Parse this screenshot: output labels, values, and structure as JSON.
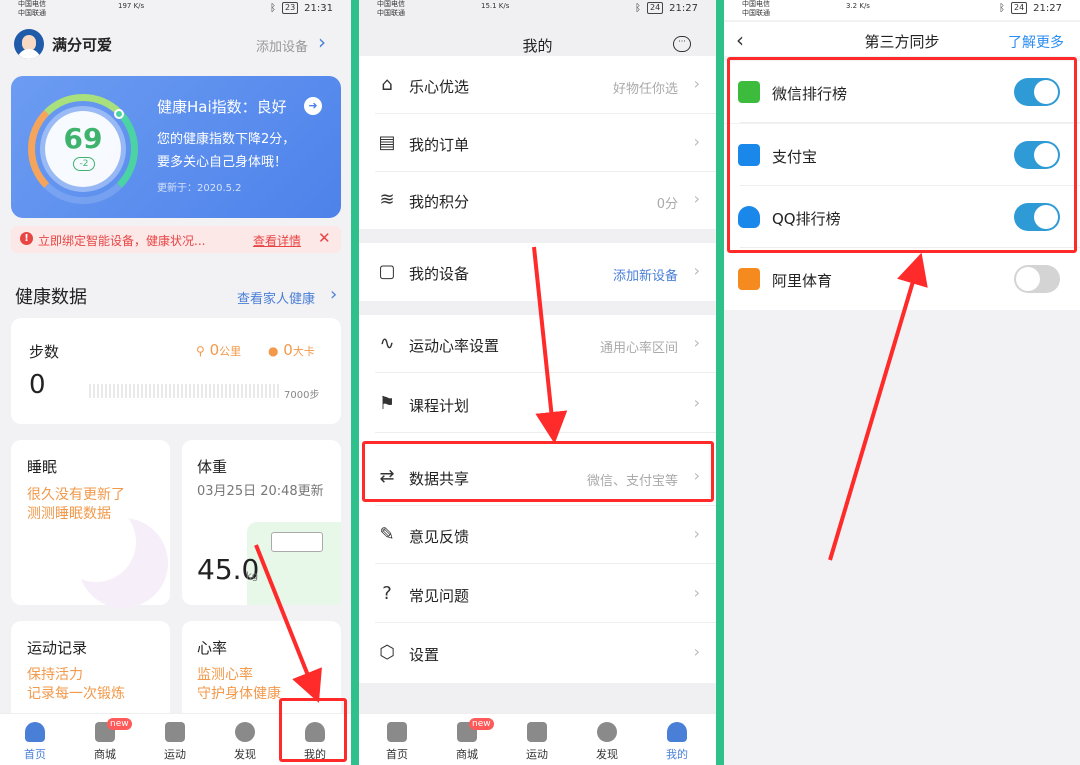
{
  "colors": {
    "accent": "#4a7fd8",
    "highlight": "#ff2a2a",
    "orange": "#f2994a",
    "toggle_on": "#2f9bd6",
    "frame": "#2fc18b"
  },
  "panel1": {
    "status": {
      "carrier1": "中国电信",
      "carrier2": "中国联通",
      "speed": "197 K/s",
      "battery": "23",
      "time": "21:31"
    },
    "user": {
      "name": "满分可爱",
      "add_device": "添加设备"
    },
    "health": {
      "title": "健康Hai指数：良好",
      "score": "69",
      "delta": "-2",
      "desc1": "您的健康指数下降2分，",
      "desc2": "要多关心自己身体哦！",
      "updated": "更新于：2020.5.2"
    },
    "alert": {
      "text": "立即绑定智能设备，健康状况...",
      "link": "查看详情"
    },
    "section": {
      "title": "健康数据",
      "link": "查看家人健康"
    },
    "steps": {
      "label": "步数",
      "value": "0",
      "distance": "0",
      "distance_unit": "公里",
      "calories": "0",
      "calories_unit": "大卡",
      "goal": "7000步"
    },
    "sleep": {
      "title": "睡眠",
      "line1": "很久没有更新了",
      "line2": "测测睡眠数据"
    },
    "weight": {
      "title": "体重",
      "date": "03月25日 20:48更新",
      "value": "45.0",
      "unit": "kg"
    },
    "sport": {
      "title": "运动记录",
      "line1": "保持活力",
      "line2": "记录每一次锻炼"
    },
    "heart": {
      "title": "心率",
      "line1": "监测心率",
      "line2": "守护身体健康"
    },
    "tabs": [
      {
        "label": "首页"
      },
      {
        "label": "商城",
        "badge": "new"
      },
      {
        "label": "运动"
      },
      {
        "label": "发现"
      },
      {
        "label": "我的"
      }
    ]
  },
  "panel2": {
    "status": {
      "carrier1": "中国电信",
      "carrier2": "中国联通",
      "speed": "15.1 K/s",
      "battery": "24",
      "time": "21:27"
    },
    "title": "我的",
    "rows": [
      {
        "icon": "lexin-icon",
        "label": "乐心优选",
        "value": "好物任你选"
      },
      {
        "icon": "order-icon",
        "label": "我的订单",
        "value": ""
      },
      {
        "icon": "points-icon",
        "label": "我的积分",
        "value": "0分"
      },
      {
        "icon": "device-icon",
        "label": "我的设备",
        "value": "添加新设备"
      },
      {
        "icon": "heartrate-icon",
        "label": "运动心率设置",
        "value": "通用心率区间"
      },
      {
        "icon": "course-icon",
        "label": "课程计划",
        "value": ""
      },
      {
        "icon": "share-icon",
        "label": "数据共享",
        "value": "微信、支付宝等"
      },
      {
        "icon": "feedback-icon",
        "label": "意见反馈",
        "value": ""
      },
      {
        "icon": "faq-icon",
        "label": "常见问题",
        "value": ""
      },
      {
        "icon": "settings-icon",
        "label": "设置",
        "value": ""
      }
    ],
    "tabs": [
      {
        "label": "首页"
      },
      {
        "label": "商城",
        "badge": "new"
      },
      {
        "label": "运动"
      },
      {
        "label": "发现"
      },
      {
        "label": "我的"
      }
    ]
  },
  "panel3": {
    "status": {
      "carrier1": "中国电信",
      "carrier2": "中国联通",
      "speed": "3.2 K/s",
      "battery": "24",
      "time": "21:27"
    },
    "title": "第三方同步",
    "more": "了解更多",
    "items": [
      {
        "icon": "wechat-icon",
        "label": "微信排行榜",
        "on": true,
        "color": "#3dbb3c"
      },
      {
        "icon": "alipay-icon",
        "label": "支付宝",
        "on": true,
        "color": "#1a88ea"
      },
      {
        "icon": "qq-icon",
        "label": "QQ排行榜",
        "on": true,
        "color": "#1a88ea"
      },
      {
        "icon": "alisports-icon",
        "label": "阿里体育",
        "on": false,
        "color": "#f58a1f"
      }
    ]
  }
}
